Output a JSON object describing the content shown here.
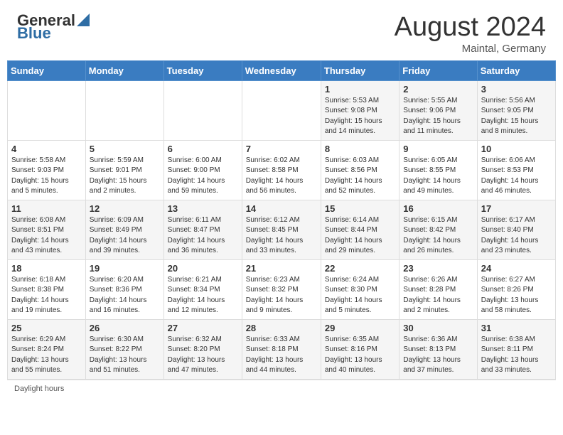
{
  "header": {
    "logo_general": "General",
    "logo_blue": "Blue",
    "month_year": "August 2024",
    "location": "Maintal, Germany"
  },
  "calendar": {
    "days_of_week": [
      "Sunday",
      "Monday",
      "Tuesday",
      "Wednesday",
      "Thursday",
      "Friday",
      "Saturday"
    ],
    "weeks": [
      [
        {
          "day": "",
          "info": ""
        },
        {
          "day": "",
          "info": ""
        },
        {
          "day": "",
          "info": ""
        },
        {
          "day": "",
          "info": ""
        },
        {
          "day": "1",
          "info": "Sunrise: 5:53 AM\nSunset: 9:08 PM\nDaylight: 15 hours\nand 14 minutes."
        },
        {
          "day": "2",
          "info": "Sunrise: 5:55 AM\nSunset: 9:06 PM\nDaylight: 15 hours\nand 11 minutes."
        },
        {
          "day": "3",
          "info": "Sunrise: 5:56 AM\nSunset: 9:05 PM\nDaylight: 15 hours\nand 8 minutes."
        }
      ],
      [
        {
          "day": "4",
          "info": "Sunrise: 5:58 AM\nSunset: 9:03 PM\nDaylight: 15 hours\nand 5 minutes."
        },
        {
          "day": "5",
          "info": "Sunrise: 5:59 AM\nSunset: 9:01 PM\nDaylight: 15 hours\nand 2 minutes."
        },
        {
          "day": "6",
          "info": "Sunrise: 6:00 AM\nSunset: 9:00 PM\nDaylight: 14 hours\nand 59 minutes."
        },
        {
          "day": "7",
          "info": "Sunrise: 6:02 AM\nSunset: 8:58 PM\nDaylight: 14 hours\nand 56 minutes."
        },
        {
          "day": "8",
          "info": "Sunrise: 6:03 AM\nSunset: 8:56 PM\nDaylight: 14 hours\nand 52 minutes."
        },
        {
          "day": "9",
          "info": "Sunrise: 6:05 AM\nSunset: 8:55 PM\nDaylight: 14 hours\nand 49 minutes."
        },
        {
          "day": "10",
          "info": "Sunrise: 6:06 AM\nSunset: 8:53 PM\nDaylight: 14 hours\nand 46 minutes."
        }
      ],
      [
        {
          "day": "11",
          "info": "Sunrise: 6:08 AM\nSunset: 8:51 PM\nDaylight: 14 hours\nand 43 minutes."
        },
        {
          "day": "12",
          "info": "Sunrise: 6:09 AM\nSunset: 8:49 PM\nDaylight: 14 hours\nand 39 minutes."
        },
        {
          "day": "13",
          "info": "Sunrise: 6:11 AM\nSunset: 8:47 PM\nDaylight: 14 hours\nand 36 minutes."
        },
        {
          "day": "14",
          "info": "Sunrise: 6:12 AM\nSunset: 8:45 PM\nDaylight: 14 hours\nand 33 minutes."
        },
        {
          "day": "15",
          "info": "Sunrise: 6:14 AM\nSunset: 8:44 PM\nDaylight: 14 hours\nand 29 minutes."
        },
        {
          "day": "16",
          "info": "Sunrise: 6:15 AM\nSunset: 8:42 PM\nDaylight: 14 hours\nand 26 minutes."
        },
        {
          "day": "17",
          "info": "Sunrise: 6:17 AM\nSunset: 8:40 PM\nDaylight: 14 hours\nand 23 minutes."
        }
      ],
      [
        {
          "day": "18",
          "info": "Sunrise: 6:18 AM\nSunset: 8:38 PM\nDaylight: 14 hours\nand 19 minutes."
        },
        {
          "day": "19",
          "info": "Sunrise: 6:20 AM\nSunset: 8:36 PM\nDaylight: 14 hours\nand 16 minutes."
        },
        {
          "day": "20",
          "info": "Sunrise: 6:21 AM\nSunset: 8:34 PM\nDaylight: 14 hours\nand 12 minutes."
        },
        {
          "day": "21",
          "info": "Sunrise: 6:23 AM\nSunset: 8:32 PM\nDaylight: 14 hours\nand 9 minutes."
        },
        {
          "day": "22",
          "info": "Sunrise: 6:24 AM\nSunset: 8:30 PM\nDaylight: 14 hours\nand 5 minutes."
        },
        {
          "day": "23",
          "info": "Sunrise: 6:26 AM\nSunset: 8:28 PM\nDaylight: 14 hours\nand 2 minutes."
        },
        {
          "day": "24",
          "info": "Sunrise: 6:27 AM\nSunset: 8:26 PM\nDaylight: 13 hours\nand 58 minutes."
        }
      ],
      [
        {
          "day": "25",
          "info": "Sunrise: 6:29 AM\nSunset: 8:24 PM\nDaylight: 13 hours\nand 55 minutes."
        },
        {
          "day": "26",
          "info": "Sunrise: 6:30 AM\nSunset: 8:22 PM\nDaylight: 13 hours\nand 51 minutes."
        },
        {
          "day": "27",
          "info": "Sunrise: 6:32 AM\nSunset: 8:20 PM\nDaylight: 13 hours\nand 47 minutes."
        },
        {
          "day": "28",
          "info": "Sunrise: 6:33 AM\nSunset: 8:18 PM\nDaylight: 13 hours\nand 44 minutes."
        },
        {
          "day": "29",
          "info": "Sunrise: 6:35 AM\nSunset: 8:16 PM\nDaylight: 13 hours\nand 40 minutes."
        },
        {
          "day": "30",
          "info": "Sunrise: 6:36 AM\nSunset: 8:13 PM\nDaylight: 13 hours\nand 37 minutes."
        },
        {
          "day": "31",
          "info": "Sunrise: 6:38 AM\nSunset: 8:11 PM\nDaylight: 13 hours\nand 33 minutes."
        }
      ]
    ]
  },
  "footer": {
    "text": "Daylight hours"
  }
}
